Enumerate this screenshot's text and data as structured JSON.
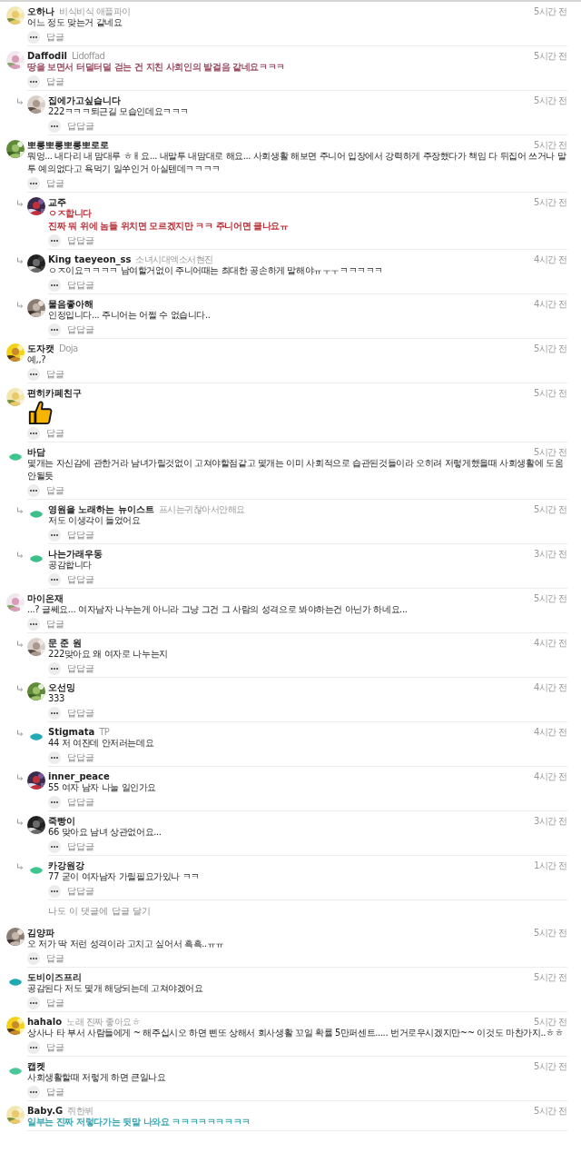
{
  "comments": [
    {
      "author": "오하나",
      "badge": "비식비식 애플파이",
      "time": "5시간 전",
      "avatar": {
        "kind": "picture"
      },
      "body": [
        {
          "kind": "text",
          "text": "어느 정도 맞는거 같네요"
        }
      ],
      "action": "답글"
    },
    {
      "author": "Daffodil",
      "badge": "Lidoffad",
      "time": "5시간 전",
      "avatar": {
        "kind": "picture"
      },
      "body": [
        {
          "kind": "text",
          "text": "땅을 보면서 터덜터덜 걷는 건 지친 사회인의 발걸음 같네요ㅋㅋㅋ",
          "color": "#9b4d63"
        }
      ],
      "action": "답글",
      "replies": [
        {
          "author": "집에가고싶습니다",
          "time": "5시간 전",
          "avatar": {
            "kind": "picture"
          },
          "body": [
            {
              "kind": "text",
              "text": "222ㅋㅋㅋ퇴근길 모습인데요ㅋㅋㅋ"
            }
          ],
          "action": "답답글"
        }
      ]
    },
    {
      "author": "뽀롱뽀롱뽀롱뽀로로",
      "time": "5시간 전",
      "avatar": {
        "kind": "picture"
      },
      "body": [
        {
          "kind": "text",
          "text": "뭐엉... 내다리 내 맘대루 ㅎㅐ요... 내말투 내맘대로 해요... 사회생활 해보면 주니어 입장에서 강력하게 주장했다가 책임 다 뒤집어 쓰거나 말투 예의없다고 욕먹기 일쑤인거 아실텐데ㅋㅋㅋㅋ"
        }
      ],
      "action": "답글",
      "replies": [
        {
          "author": "교주",
          "time": "5시간 전",
          "avatar": {
            "kind": "picture"
          },
          "body": [
            {
              "kind": "text",
              "text": "ㅇㅈ합니다",
              "color": "#b8323a"
            },
            {
              "kind": "text",
              "text": "진짜 뭐 위에 놈들 위치면 모르겠지만 ㅋㅋ 주니어면 클나요ㅠ",
              "color": "#b8323a"
            }
          ],
          "action": "답답글"
        },
        {
          "author": "King taeyeon_ss",
          "badge": "소녀시대엑소서현진",
          "time": "4시간 전",
          "avatar": {
            "kind": "picture"
          },
          "body": [
            {
              "kind": "text",
              "text": "ㅇㅈ이요ㅋㅋㅋㅋ 남여할거없이 주니어때는 최대한 공손하게 말해야ㅠㅜㅜㅋㅋㅋㅋㅋ"
            }
          ],
          "action": "답답글"
        },
        {
          "author": "물음좋아해",
          "time": "4시간 전",
          "avatar": {
            "kind": "picture"
          },
          "body": [
            {
              "kind": "text",
              "text": "인정입니다... 주니어는 어쩔 수 없습니다.."
            }
          ],
          "action": "답답글"
        }
      ]
    },
    {
      "author": "도자캣",
      "badge": "Doja",
      "time": "5시간 전",
      "avatar": {
        "kind": "picture"
      },
      "body": [
        {
          "kind": "text",
          "text": "예,,?"
        }
      ],
      "action": "답글"
    },
    {
      "author": "편히카페친구",
      "time": "5시간 전",
      "avatar": {
        "kind": "picture"
      },
      "body": [
        {
          "kind": "sticker"
        }
      ],
      "action": "답글"
    },
    {
      "author": "바담",
      "time": "5시간 전",
      "avatar": {
        "kind": "leaf",
        "color": "#3ec48e"
      },
      "body": [
        {
          "kind": "text",
          "text": "몇개는 자신감에 관한거라 남녀가릴것없이 고쳐야할점같고 몇개는 이미 사회적으로 습관된것들이라 오히려 저렇게했을때 사회생활에 도움안될듯"
        }
      ],
      "action": "답글",
      "replies": [
        {
          "author": "영원을 노래하는 뉴이스트",
          "badge": "프시는귀찮아서안해요",
          "time": "5시간 전",
          "avatar": {
            "kind": "leaf",
            "color": "#3cbf8a"
          },
          "body": [
            {
              "kind": "text",
              "text": "저도 이생각이 들었어요"
            }
          ],
          "action": "답답글"
        },
        {
          "author": "나는가래우동",
          "time": "3시간 전",
          "avatar": {
            "kind": "leaf",
            "color": "#3cbf8a"
          },
          "body": [
            {
              "kind": "text",
              "text": "공감합니다"
            }
          ],
          "action": "답답글"
        }
      ]
    },
    {
      "author": "마이온재",
      "time": "5시간 전",
      "avatar": {
        "kind": "picture"
      },
      "body": [
        {
          "kind": "text",
          "text": "...? 글쎄요... 여자남자 나누는게 아니라 그냥 그건 그 사람의 성격으로 봐야하는건 아닌가 하네요..."
        }
      ],
      "action": "답글",
      "replies": [
        {
          "author": "문 준 원",
          "time": "4시간 전",
          "avatar": {
            "kind": "picture"
          },
          "body": [
            {
              "kind": "text",
              "text": "222맞아요 왜 여자로 나누는지"
            }
          ],
          "action": "답답글"
        },
        {
          "author": "오선밍",
          "time": "4시간 전",
          "avatar": {
            "kind": "picture"
          },
          "body": [
            {
              "kind": "text",
              "text": "333"
            }
          ],
          "action": "답답글"
        },
        {
          "author": "Stigmata",
          "badge": "TP",
          "time": "4시간 전",
          "avatar": {
            "kind": "leaf",
            "color": "#23aab5"
          },
          "body": [
            {
              "kind": "text",
              "text": "44 저 여잔데 안저러는데요"
            }
          ],
          "action": "답답글"
        },
        {
          "author": "inner_peace",
          "time": "4시간 전",
          "avatar": {
            "kind": "picture"
          },
          "body": [
            {
              "kind": "text",
              "text": "55 여자 남자 나눌 일인가요"
            }
          ],
          "action": "답답글"
        },
        {
          "author": "죽빵이",
          "time": "3시간 전",
          "avatar": {
            "kind": "picture"
          },
          "body": [
            {
              "kind": "text",
              "text": "66 맞아요 남녀 상관없어요..."
            }
          ],
          "action": "답답글"
        },
        {
          "author": "카강원강",
          "time": "1시간 전",
          "avatar": {
            "kind": "leaf",
            "color": "#3ec48e"
          },
          "body": [
            {
              "kind": "text",
              "text": "77 굳이 여자남자 가릴필요가있나 ㅋㅋ"
            }
          ],
          "action": "답답글"
        }
      ],
      "reply_prompt": "나도 이 댓글에 답글 달기"
    },
    {
      "author": "김양파",
      "time": "5시간 전",
      "avatar": {
        "kind": "picture"
      },
      "body": [
        {
          "kind": "text",
          "text": "오 저가 딱 저런 성격이라 고치고 싶어서 흑흑..ㅠㅠ"
        }
      ],
      "action": "답글"
    },
    {
      "author": "도비이즈프리",
      "time": "5시간 전",
      "avatar": {
        "kind": "leaf",
        "color": "#1fa9b0"
      },
      "body": [
        {
          "kind": "text",
          "text": "공감된다 저도 몇개 해당되는데 고쳐야겠어요"
        }
      ],
      "action": "답글"
    },
    {
      "author": "hahalo",
      "badge": "노래 진짜 좋아요ㅎ",
      "time": "5시간 전",
      "avatar": {
        "kind": "picture"
      },
      "body": [
        {
          "kind": "text",
          "text": "상사나 타 부서 사람들에게 ~ 해주십시오 하면 삔또 상해서 회사생활 꼬일 확률 5만퍼센트..... 번거로우시겠지만~~ 이것도 마찬가지..ㅎㅎ"
        }
      ],
      "action": "답글"
    },
    {
      "author": "캡켓",
      "time": "5시간 전",
      "avatar": {
        "kind": "leaf",
        "color": "#4cc79a"
      },
      "body": [
        {
          "kind": "text",
          "text": "사회생활할때 저렇게 하면 큰일나요"
        }
      ],
      "action": "답글"
    },
    {
      "author": "Baby.G",
      "badge": "쥐한뷔",
      "time": "5시간 전",
      "avatar": {
        "kind": "picture"
      },
      "body": [
        {
          "kind": "text",
          "text": "일부는 진짜 저렇다가는 뒷말 나와요 ㅋㅋㅋㅋㅋㅋㅋㅋㅋ",
          "color": "#3aa6b0"
        }
      ]
    }
  ]
}
